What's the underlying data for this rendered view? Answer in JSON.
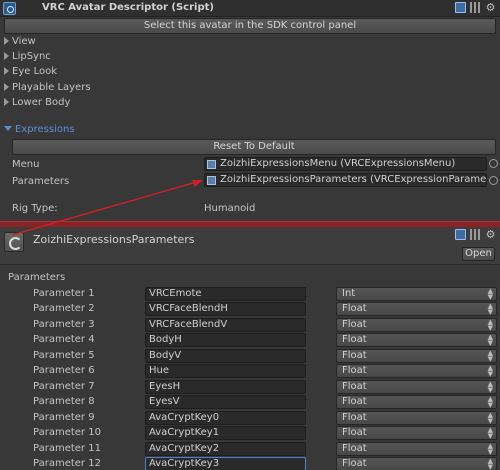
{
  "component": {
    "title": "VRC Avatar Descriptor (Script)",
    "select_button": "Select this avatar in the SDK control panel"
  },
  "foldouts": [
    "View",
    "LipSync",
    "Eye Look",
    "Playable Layers",
    "Lower Body"
  ],
  "expressions": {
    "heading": "Expressions",
    "reset_button": "Reset To Default",
    "menu_label": "Menu",
    "menu_value": "ZoizhiExpressionsMenu (VRCExpressionsMenu)",
    "parameters_label": "Parameters",
    "parameters_value": "ZoizhiExpressionsParameters (VRCExpressionParamet"
  },
  "rig": {
    "label": "Rig Type:",
    "value": "Humanoid"
  },
  "asset": {
    "title": "ZoizhiExpressionsParameters",
    "open_button": "Open",
    "section_label": "Parameters"
  },
  "parameters": [
    {
      "label": "Parameter 1",
      "name": "VRCEmote",
      "type": "Int"
    },
    {
      "label": "Parameter 2",
      "name": "VRCFaceBlendH",
      "type": "Float"
    },
    {
      "label": "Parameter 3",
      "name": "VRCFaceBlendV",
      "type": "Float"
    },
    {
      "label": "Parameter 4",
      "name": "BodyH",
      "type": "Float"
    },
    {
      "label": "Parameter 5",
      "name": "BodyV",
      "type": "Float"
    },
    {
      "label": "Parameter 6",
      "name": "Hue",
      "type": "Float"
    },
    {
      "label": "Parameter 7",
      "name": "EyesH",
      "type": "Float"
    },
    {
      "label": "Parameter 8",
      "name": "EyesV",
      "type": "Float"
    },
    {
      "label": "Parameter 9",
      "name": "AvaCryptKey0",
      "type": "Float"
    },
    {
      "label": "Parameter 10",
      "name": "AvaCryptKey1",
      "type": "Float"
    },
    {
      "label": "Parameter 11",
      "name": "AvaCryptKey2",
      "type": "Float"
    },
    {
      "label": "Parameter 12",
      "name": "AvaCryptKey3",
      "type": "Float"
    }
  ],
  "colors": {
    "accent": "#5a8fd9",
    "divider": "#8a2323",
    "annotation_arrow": "#c8202a"
  }
}
